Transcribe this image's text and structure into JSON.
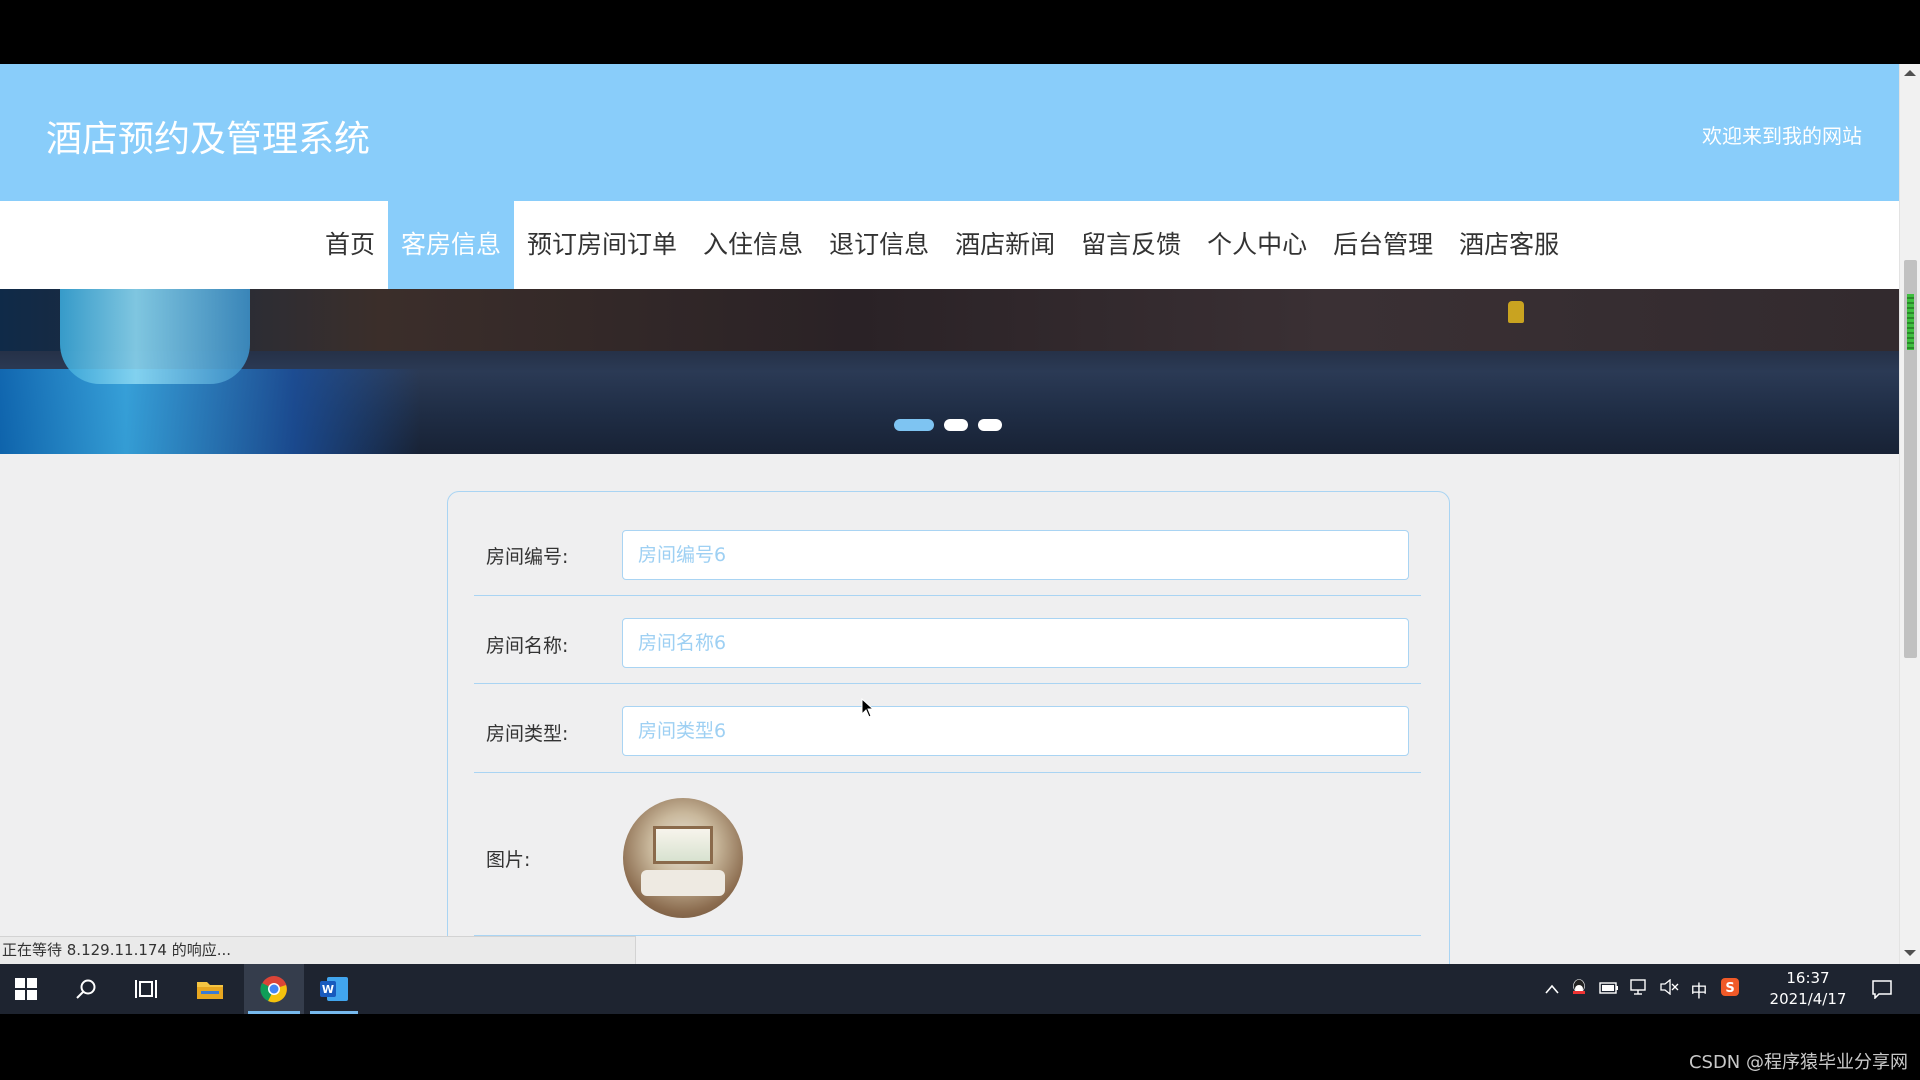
{
  "site": {
    "title": "酒店预约及管理系统",
    "welcome": "欢迎来到我的网站"
  },
  "nav": {
    "items": [
      "首页",
      "客房信息",
      "预订房间订单",
      "入住信息",
      "退订信息",
      "酒店新闻",
      "留言反馈",
      "个人中心",
      "后台管理",
      "酒店客服"
    ],
    "active_index": 1
  },
  "carousel": {
    "slide_count": 3,
    "active_slide": 1
  },
  "form": {
    "fields": [
      {
        "label": "房间编号:",
        "placeholder": "房间编号6"
      },
      {
        "label": "房间名称:",
        "placeholder": "房间名称6"
      },
      {
        "label": "房间类型:",
        "placeholder": "房间类型6"
      }
    ],
    "image_label": "图片:"
  },
  "browser": {
    "status_text": "正在等待 8.129.11.174 的响应..."
  },
  "taskbar": {
    "apps": [
      "windows-start",
      "search",
      "task-view",
      "file-explorer",
      "chrome",
      "word"
    ],
    "tray_ime": "中",
    "time": "16:37",
    "date": "2021/4/17"
  },
  "watermark": "CSDN @程序猿毕业分享网",
  "colors": {
    "accent": "#89cdfa",
    "border": "#a9d4f3",
    "placeholder": "#9ed0f3"
  }
}
